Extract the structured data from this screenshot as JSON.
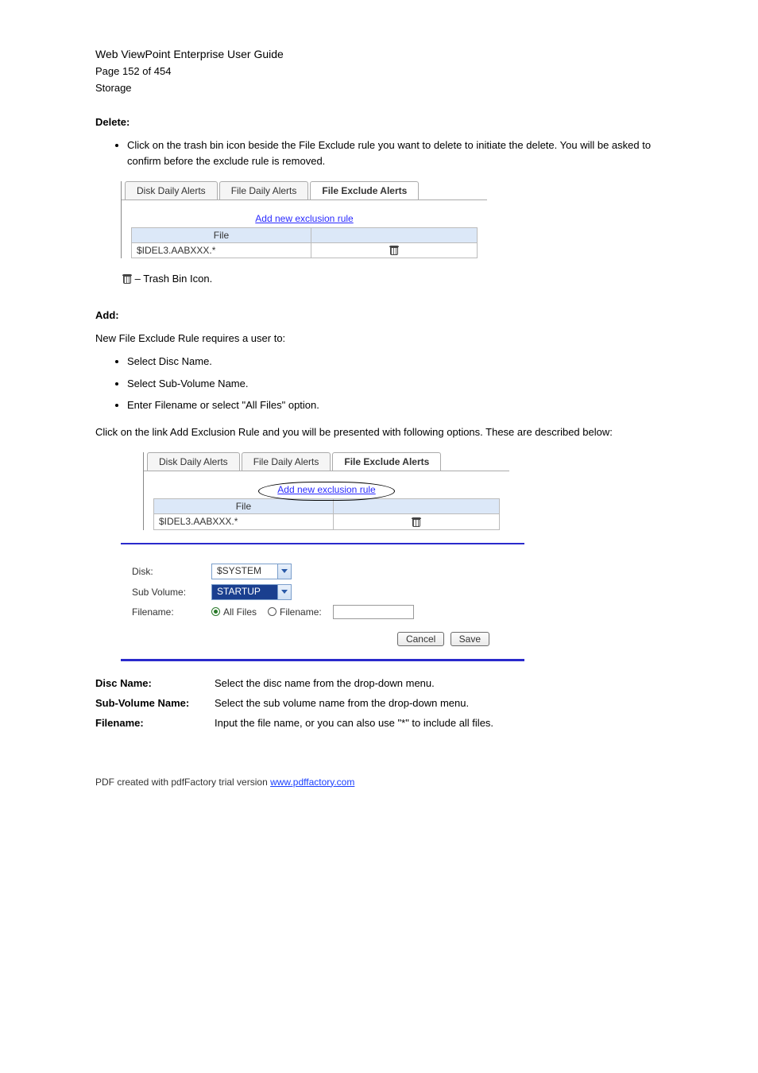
{
  "header": {
    "product": "Web ViewPoint Enterprise User Guide",
    "page_label": "Page 152 of 454",
    "section": "Storage"
  },
  "delete_section": {
    "title": "Delete:",
    "steps": [
      "Click on the trash bin icon beside the File Exclude rule you want to delete to initiate the delete. You will be asked to confirm before the exclude rule is removed."
    ]
  },
  "figure1": {
    "tabs": [
      "Disk Daily Alerts",
      "File Daily Alerts",
      "File Exclude Alerts"
    ],
    "active_tab_index": 2,
    "add_link": "Add new exclusion rule",
    "table": {
      "col": "File",
      "row_value": "$IDEL3.AABXXX.*"
    }
  },
  "trash_ref": {
    "text": "– Trash Bin Icon."
  },
  "add_section": {
    "title": "Add:",
    "new_rule_bullets": [
      "Select Disc Name.",
      "Select Sub-Volume Name.",
      "Enter Filename or select \"All Files\" option."
    ],
    "click_link_text": "Click on the link Add Exclusion Rule and you will be presented with following options. These are described below:"
  },
  "dialog": {
    "disk_label": "Disk:",
    "disk_value": "$SYSTEM",
    "subvol_label": "Sub Volume:",
    "subvol_value": "STARTUP",
    "filename_label": "Filename:",
    "radio_all": "All Files",
    "radio_file": "Filename:",
    "cancel": "Cancel",
    "save": "Save"
  },
  "options": {
    "rows": [
      {
        "label": "Disc Name:",
        "desc": "Select the disc name from the drop-down menu."
      },
      {
        "label": "Sub-Volume Name:",
        "desc": "Select the sub volume name from the drop-down menu."
      },
      {
        "label": "Filename:",
        "desc": "Input the file name, or you can also use \"*\" to include all files."
      }
    ]
  },
  "footer": {
    "pdf_note": "PDF created with pdfFactory trial version",
    "pdf_url": "www.pdffactory.com"
  }
}
